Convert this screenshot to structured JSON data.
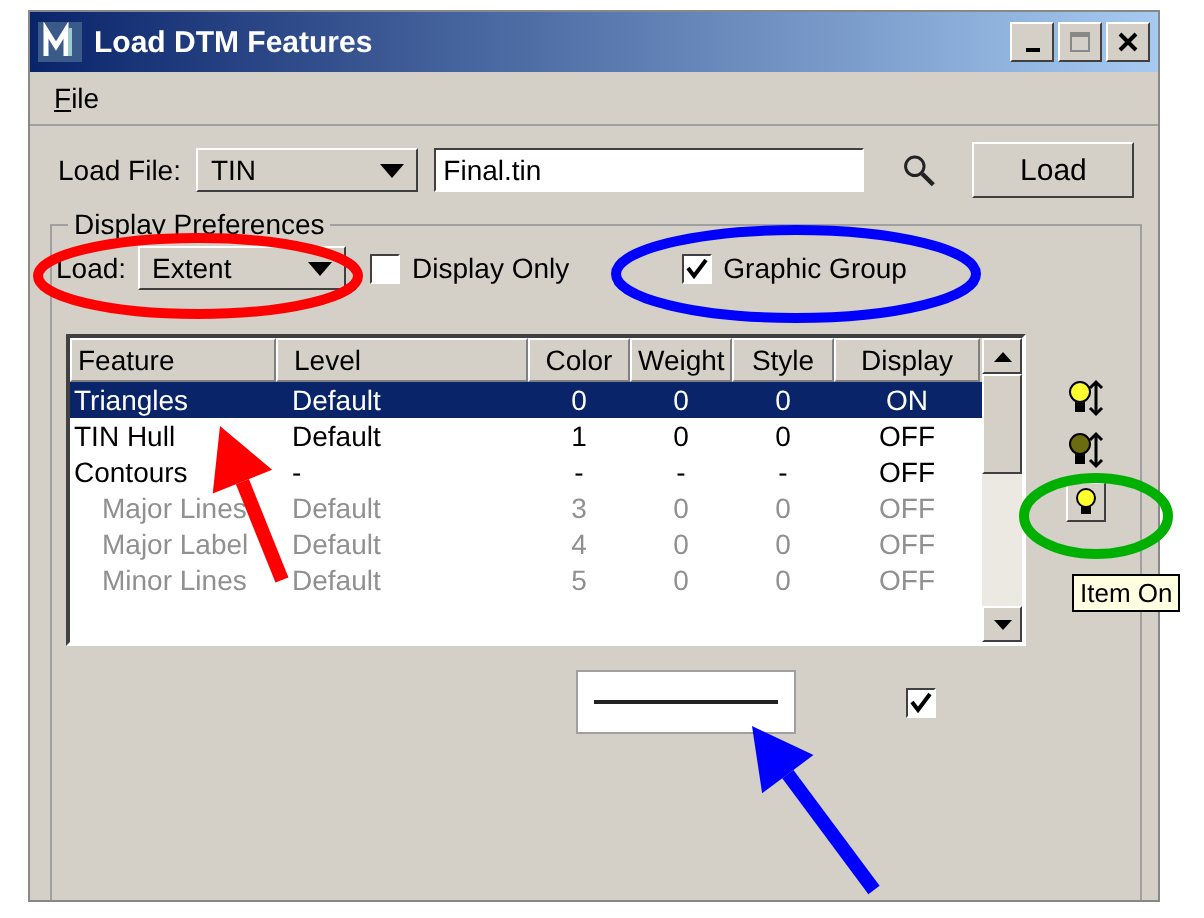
{
  "window": {
    "title": "Load DTM Features"
  },
  "menu": [
    "File"
  ],
  "load_file": {
    "label": "Load File:",
    "type": "TIN",
    "file": "Final.tin",
    "button": "Load"
  },
  "display_preferences": {
    "title": "Display Preferences",
    "load_label": "Load:",
    "load_value": "Extent",
    "display_only": {
      "label": "Display Only",
      "checked": false
    },
    "graphic_group": {
      "label": "Graphic Group",
      "checked": true
    }
  },
  "table": {
    "columns": [
      "Feature",
      "Level",
      "Color",
      "Weight",
      "Style",
      "Display"
    ],
    "rows": [
      {
        "cells": [
          "Triangles",
          "Default",
          "0",
          "0",
          "0",
          "ON"
        ],
        "selected": true,
        "disabled": false
      },
      {
        "cells": [
          "TIN Hull",
          "Default",
          "1",
          "0",
          "0",
          "OFF"
        ],
        "selected": false,
        "disabled": false
      },
      {
        "cells": [
          "Contours",
          "-",
          "-",
          "-",
          "-",
          "OFF"
        ],
        "selected": false,
        "disabled": false,
        "children": [
          {
            "cells": [
              "Major Lines",
              "Default",
              "3",
              "0",
              "0",
              "OFF"
            ],
            "selected": false,
            "disabled": true
          },
          {
            "cells": [
              "Major Label",
              "Default",
              "4",
              "0",
              "0",
              "OFF"
            ],
            "selected": false,
            "disabled": true
          },
          {
            "cells": [
              "Minor Lines",
              "Default",
              "5",
              "0",
              "0",
              "OFF"
            ],
            "selected": false,
            "disabled": true
          }
        ]
      }
    ]
  },
  "tooltip": "Item On",
  "symbology": {
    "checked": true
  },
  "annotations": [
    {
      "kind": "ellipse",
      "color": "#ff0000"
    },
    {
      "kind": "ellipse",
      "color": "#0000ff"
    },
    {
      "kind": "ellipse",
      "color": "#00b000"
    },
    {
      "kind": "arrow",
      "color": "#ff0000"
    },
    {
      "kind": "arrow",
      "color": "#0000ff"
    }
  ]
}
